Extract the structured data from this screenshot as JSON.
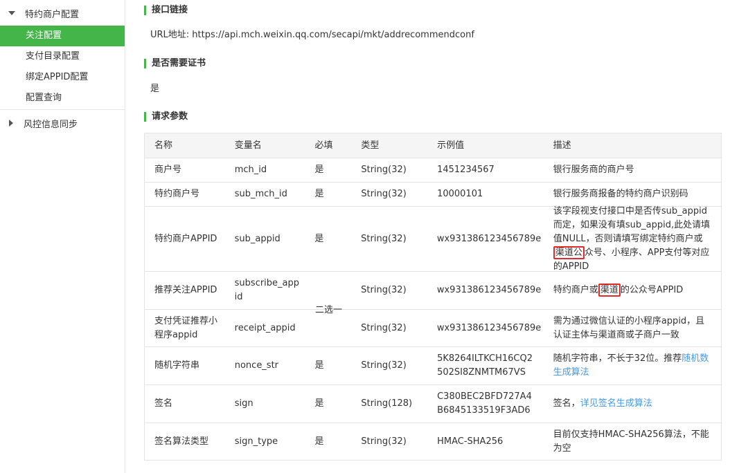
{
  "sidebar": {
    "group1": {
      "label": "特约商户配置",
      "icon": "caret-down-icon"
    },
    "items": [
      {
        "label": "关注配置",
        "active": true
      },
      {
        "label": "支付目录配置",
        "active": false
      },
      {
        "label": "绑定APPID配置",
        "active": false
      },
      {
        "label": "配置查询",
        "active": false
      }
    ],
    "group2": {
      "label": "风控信息同步",
      "icon": "caret-right-icon"
    }
  },
  "sections": {
    "api": {
      "title": "接口链接",
      "body": "URL地址: https://api.mch.weixin.qq.com/secapi/mkt/addrecommendconf"
    },
    "cert": {
      "title": "是否需要证书",
      "body": "是"
    },
    "params": {
      "title": "请求参数"
    }
  },
  "table": {
    "headers": [
      "名称",
      "变量名",
      "必填",
      "类型",
      "示例值",
      "描述"
    ],
    "either_label": "二选一",
    "rows": [
      {
        "name": "商户号",
        "var": "mch_id",
        "req": "是",
        "type": "String(32)",
        "example": "1451234567",
        "desc": "银行服务商的商户号"
      },
      {
        "name": "特约商户号",
        "var": "sub_mch_id",
        "req": "是",
        "type": "String(32)",
        "example": "10000101",
        "desc": "银行服务商报备的特约商户识别码"
      },
      {
        "name": "特约商户APPID",
        "var": "sub_appid",
        "req": "是",
        "type": "String(32)",
        "example": "wx931386123456789e",
        "desc_a": "该字段视支付接口中是否传sub_appid而定，如果没有填sub_appid,此处请填值NULL，否则请填写绑定特约商户或",
        "desc_hl": "渠道公",
        "desc_b": "众号、小程序、APP支付等对应的APPID"
      },
      {
        "name": "推荐关注APPID",
        "var": "subscribe_appid",
        "req": "",
        "type": "String(32)",
        "example": "wx931386123456789e",
        "desc_a": "特约商户或",
        "desc_hl": "渠道",
        "desc_b": "的公众号APPID"
      },
      {
        "name": "支付凭证推荐小程序appid",
        "var": "receipt_appid",
        "req": "",
        "type": "String(32)",
        "example": "wx931386123456789e",
        "desc": "需为通过微信认证的小程序appid，且认证主体与渠道商或子商户一致"
      },
      {
        "name": "随机字符串",
        "var": "nonce_str",
        "req": "是",
        "type": "String(32)",
        "example": "5K8264ILTKCH16CQ2502SI8ZNMTM67VS",
        "desc_a": "随机字符串，不长于32位。推荐",
        "desc_link": "随机数生成算法"
      },
      {
        "name": "签名",
        "var": "sign",
        "req": "是",
        "type": "String(128)",
        "example": "C380BEC2BFD727A4B6845133519F3AD6",
        "desc_a": "签名，",
        "desc_link": "详见签名生成算法"
      },
      {
        "name": "签名算法类型",
        "var": "sign_type",
        "req": "是",
        "type": "String(32)",
        "example": "HMAC-SHA256",
        "desc": "目前仅支持HMAC-SHA256算法，不能为空"
      }
    ]
  },
  "colors": {
    "accent": "#44b549",
    "link": "#459ae9",
    "highlight_box": "#e02b2b"
  }
}
